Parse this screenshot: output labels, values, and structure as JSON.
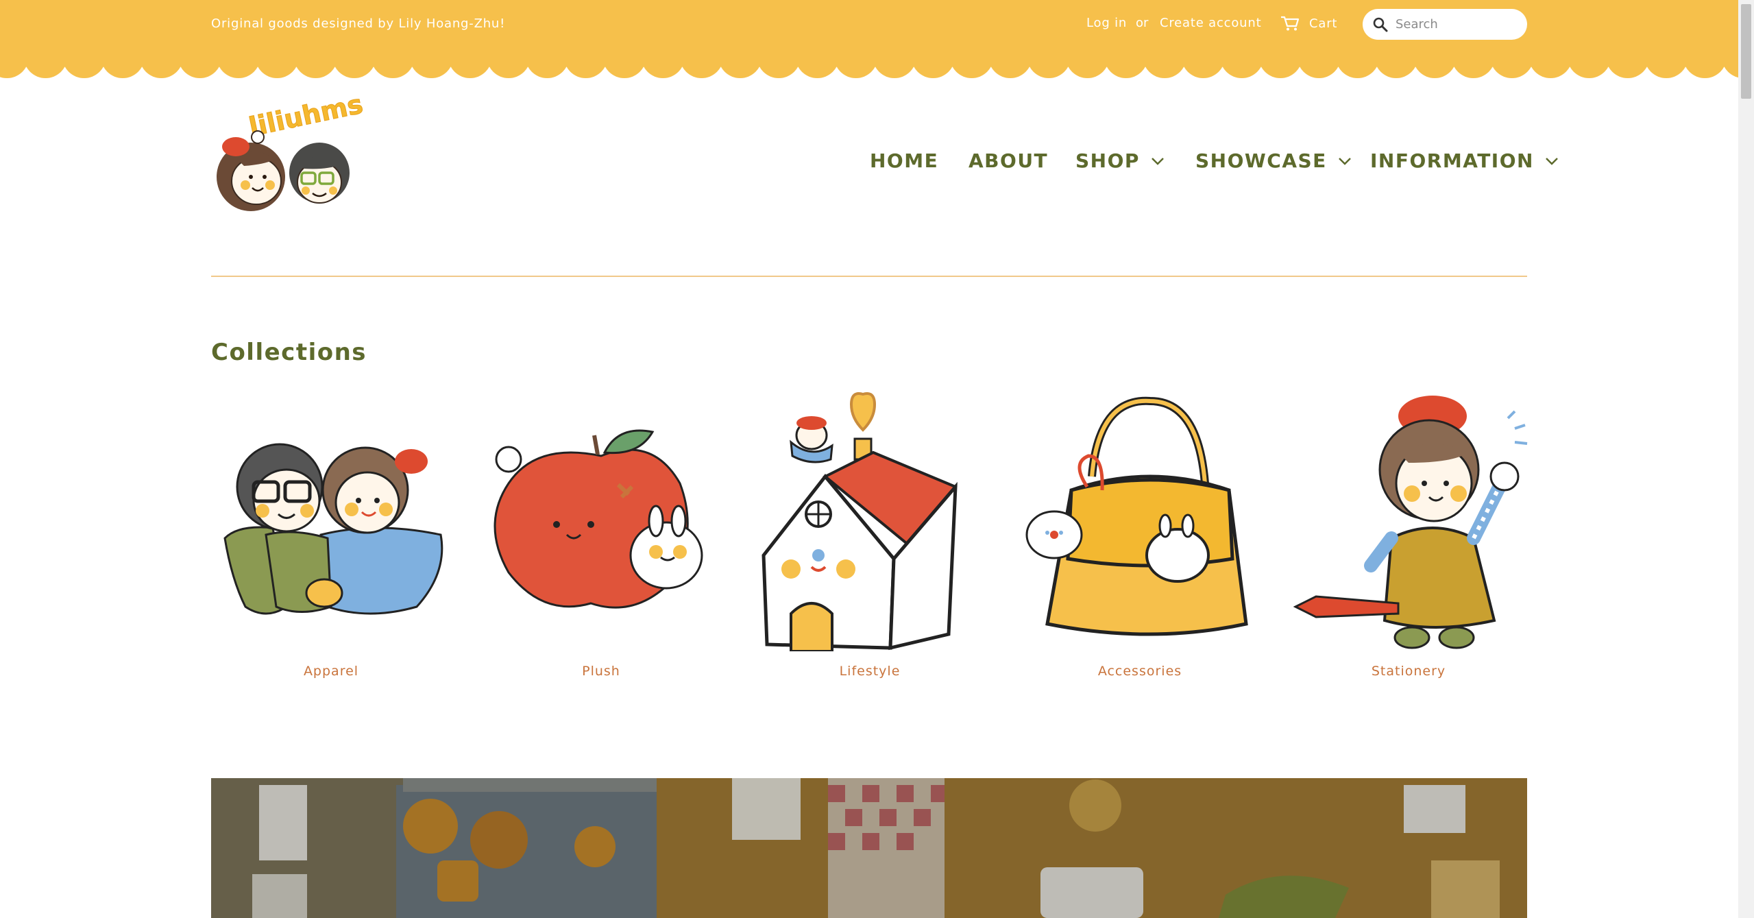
{
  "topbar": {
    "tagline": "Original goods designed by Lily Hoang-Zhu!",
    "login": "Log in",
    "or": "or",
    "create_account": "Create account",
    "cart": "Cart",
    "search_placeholder": "Search"
  },
  "logo": {
    "text": "liliuhms"
  },
  "nav": {
    "home": "HOME",
    "about": "ABOUT",
    "shop": "SHOP",
    "showcase": "SHOWCASE",
    "information": "INFORMATION"
  },
  "collections": {
    "title": "Collections",
    "items": [
      {
        "label": "Apparel",
        "icon": "two-girls-hugging-icon"
      },
      {
        "label": "Plush",
        "icon": "apple-with-bunny-icon"
      },
      {
        "label": "Lifestyle",
        "icon": "house-icon"
      },
      {
        "label": "Accessories",
        "icon": "yellow-handbag-icon"
      },
      {
        "label": "Stationery",
        "icon": "girl-with-pencil-icon"
      }
    ]
  },
  "colors": {
    "topbar": "#f6c04b",
    "nav_text": "#5d6a2c",
    "collection_label": "#c9743c",
    "divider": "#f1c98a"
  }
}
